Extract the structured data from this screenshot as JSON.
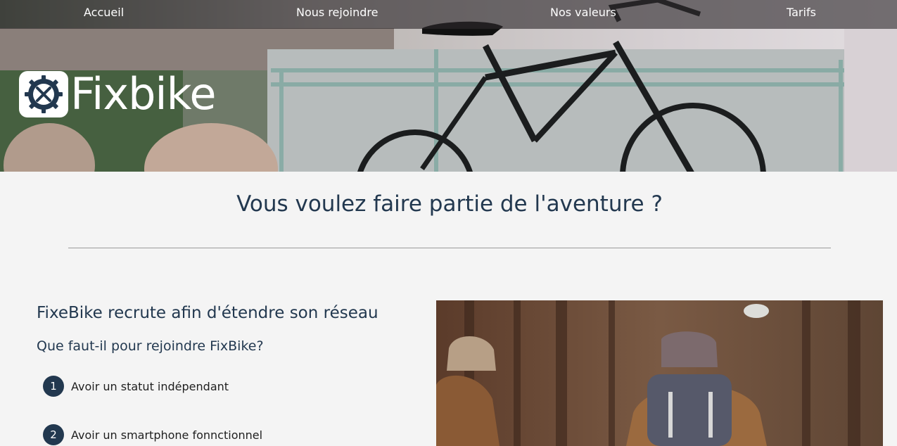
{
  "nav": {
    "items": [
      {
        "label": "Accueil"
      },
      {
        "label": "Nous rejoindre"
      },
      {
        "label": "Nos valeurs"
      },
      {
        "label": "Tarifs"
      }
    ]
  },
  "brand": {
    "name": "Fixbike",
    "icon": "gear-wrench-icon"
  },
  "section": {
    "title": "Vous voulez faire partie de l'aventure ?"
  },
  "recruit": {
    "title": "FixeBike recrute afin d'étendre son réseau",
    "subtitle": "Que faut-il pour rejoindre FixBike?",
    "requirements": [
      {
        "number": "1",
        "text": "Avoir un statut indépendant"
      },
      {
        "number": "2",
        "text": "Avoir un smartphone fonnctionnel"
      }
    ]
  },
  "colors": {
    "primary": "#22384f",
    "nav_overlay": "#2d282c",
    "page_background": "#f4f4f4"
  }
}
